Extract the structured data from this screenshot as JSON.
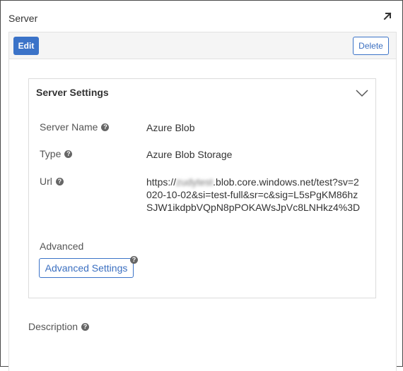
{
  "window": {
    "title": "Server",
    "expand_icon": "expand-arrow-icon"
  },
  "toolbar": {
    "edit_label": "Edit",
    "delete_label": "Delete",
    "accent_color": "#3b73c8"
  },
  "server_settings": {
    "title": "Server Settings",
    "collapse_icon": "chevron-down-icon",
    "fields": {
      "server_name": {
        "label": "Server Name",
        "value": "Azure Blob"
      },
      "type": {
        "label": "Type",
        "value": "Azure Blob Storage"
      },
      "url": {
        "label": "Url",
        "value_prefix": "https://",
        "value_redacted": "zudytest",
        "value_suffix": ".blob.core.windows.net/test?sv=2020-10-02&si=test-full&sr=c&sig=L5sPgKM86hzSJW1ikdpbVQpN8pPOKAWsJpVc8LNHkz4%3D"
      }
    },
    "advanced": {
      "label": "Advanced",
      "button_label": "Advanced Settings"
    }
  },
  "description": {
    "label": "Description"
  },
  "help_glyph": "?"
}
